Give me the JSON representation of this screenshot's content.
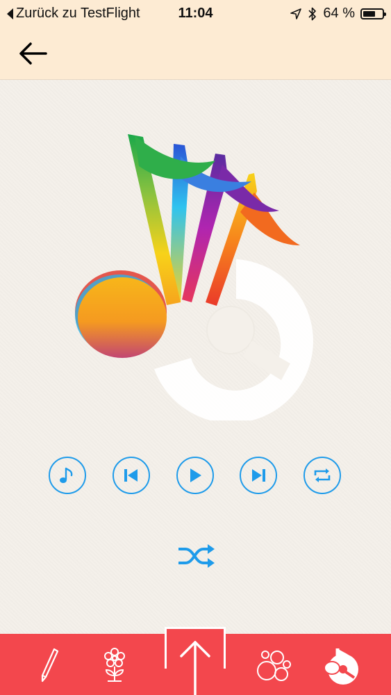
{
  "status_bar": {
    "back_label": "Zurück zu TestFlight",
    "time": "11:04",
    "battery_text": "64 %",
    "battery_level": 0.64,
    "icons": [
      "location-arrow-icon",
      "bluetooth-icon",
      "battery-icon"
    ]
  },
  "nav": {
    "back_icon": "arrow-left-icon"
  },
  "logo": {
    "icon": "rainbow-music-note-disc-logo"
  },
  "controls": [
    {
      "name": "music-note-icon"
    },
    {
      "name": "skip-previous-icon"
    },
    {
      "name": "play-icon"
    },
    {
      "name": "skip-next-icon"
    },
    {
      "name": "repeat-icon"
    }
  ],
  "shuffle": {
    "icon": "shuffle-icon"
  },
  "tab_bar": {
    "tabs": [
      "pencil-icon",
      "flower-icon",
      "upload-icon",
      "circles-icon",
      "music-disc-icon"
    ],
    "selected": "music-disc-icon"
  },
  "colors": {
    "accent_blue": "#1e9bea",
    "tab_bar_red": "#f3474d",
    "header_peach": "#fdebd3",
    "paper": "#f4f0ea"
  }
}
